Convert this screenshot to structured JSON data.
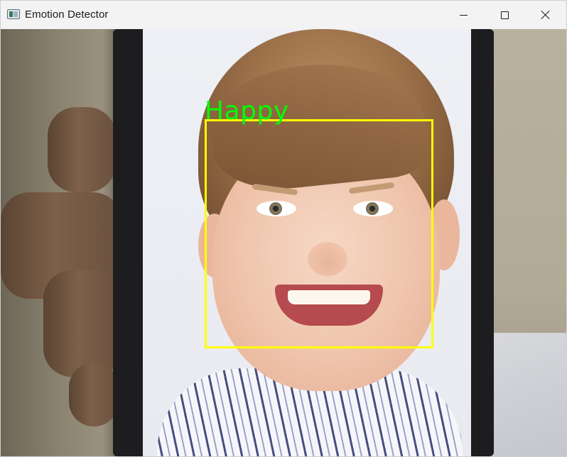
{
  "window": {
    "title": "Emotion Detector",
    "app_icon": "app-window-icon",
    "controls": {
      "minimize_icon": "minimize-icon",
      "maximize_icon": "maximize-icon",
      "close_icon": "close-icon"
    }
  },
  "detection": {
    "label": "Happy",
    "box_color": "#ffff00",
    "label_color": "#00ff00"
  }
}
